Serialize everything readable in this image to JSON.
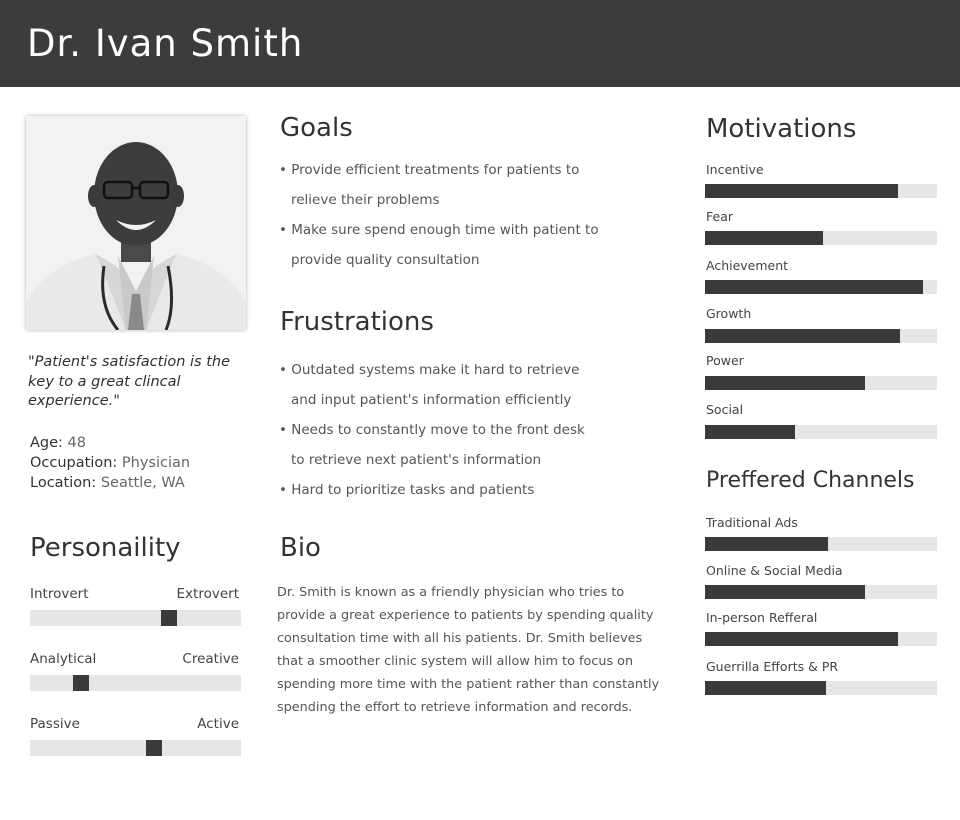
{
  "header": {
    "name": "Dr. Ivan Smith"
  },
  "profile": {
    "quote": "\"Patient's satisfaction is the key to a great clincal experience.\"",
    "facts": [
      {
        "label": "Age:",
        "value": "48"
      },
      {
        "label": "Occupation:",
        "value": "Physician"
      },
      {
        "label": "Location:",
        "value": "Seattle, WA"
      }
    ]
  },
  "goals": {
    "title": "Goals",
    "items": [
      {
        "line1": "• Provide efficient treatments for patients to",
        "line2": "relieve their problems"
      },
      {
        "line1": "• Make sure spend enough time with patient to",
        "line2": "provide quality consultation"
      }
    ]
  },
  "frustrations": {
    "title": "Frustrations",
    "items": [
      {
        "line1": "• Outdated systems make it hard to retrieve",
        "line2": "and input patient's information efficiently"
      },
      {
        "line1": "• Needs to constantly move to the front desk",
        "line2": "to retrieve next patient's information"
      },
      {
        "line1": "• Hard to prioritize tasks and patients",
        "line2": ""
      }
    ]
  },
  "bio": {
    "title": "Bio",
    "text": "Dr. Smith is known as a friendly physician who tries to provide a great experience to patients by spending quality consultation time with all his patients. Dr. Smith believes that a smoother clinic system will allow him to focus on spending more time with the patient rather than constantly spending the effort to retrieve information and records."
  },
  "personality": {
    "title": "Personaility",
    "traits": [
      {
        "left": "Introvert",
        "right": "Extrovert",
        "level": 0.66
      },
      {
        "left": "Analytical",
        "right": "Creative",
        "level": 0.24
      },
      {
        "left": "Passive",
        "right": "Active",
        "level": 0.59
      }
    ]
  },
  "motivations": {
    "title": "Motivations",
    "items": [
      {
        "label": "Incentive",
        "level": 0.83
      },
      {
        "label": "Fear",
        "level": 0.51
      },
      {
        "label": "Achievement",
        "level": 0.94
      },
      {
        "label": "Growth",
        "level": 0.84
      },
      {
        "label": "Power",
        "level": 0.69
      },
      {
        "label": "Social",
        "level": 0.39
      }
    ]
  },
  "channels": {
    "title": "Preffered Channels",
    "items": [
      {
        "label": "Traditional Ads",
        "level": 0.53
      },
      {
        "label": "Online & Social Media",
        "level": 0.69
      },
      {
        "label": "In-person Refferal",
        "level": 0.83
      },
      {
        "label": "Guerrilla Efforts & PR",
        "level": 0.52
      }
    ]
  },
  "colors": {
    "header_bg": "#3c3c3c",
    "bar_fill": "#3a3a3a",
    "bar_track": "#e6e6e6"
  }
}
